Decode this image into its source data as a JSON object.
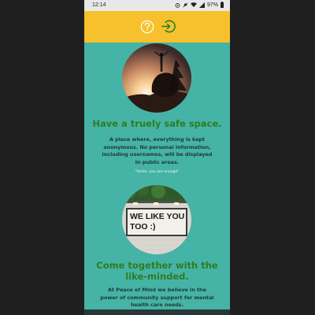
{
  "status_bar": {
    "time": "12:14",
    "battery": "97%",
    "icons": [
      "alarm-icon",
      "silent-icon",
      "wifi-icon",
      "signal-icon",
      "battery-icon"
    ]
  },
  "header": {
    "background": "#f6c12c",
    "icons": [
      "help-icon",
      "login-icon"
    ]
  },
  "colors": {
    "content_background": "#45b3a6",
    "heading": "#2e7d1e",
    "body_text": "#1d3a34"
  },
  "section1": {
    "heading": "Have a truely safe space.",
    "body": "A place where, everything is kept anonymous. No personal information, including usernames, will be displayed in public areas.",
    "quote": "\"Smile, you are enough\""
  },
  "section2": {
    "sign_text_line1": "WE LIKE YOU",
    "sign_text_line2": "TOO :)",
    "heading": "Come together with the like-minded.",
    "body": "At Peace of Mind we believe in the power of community support for mental health care needs."
  }
}
